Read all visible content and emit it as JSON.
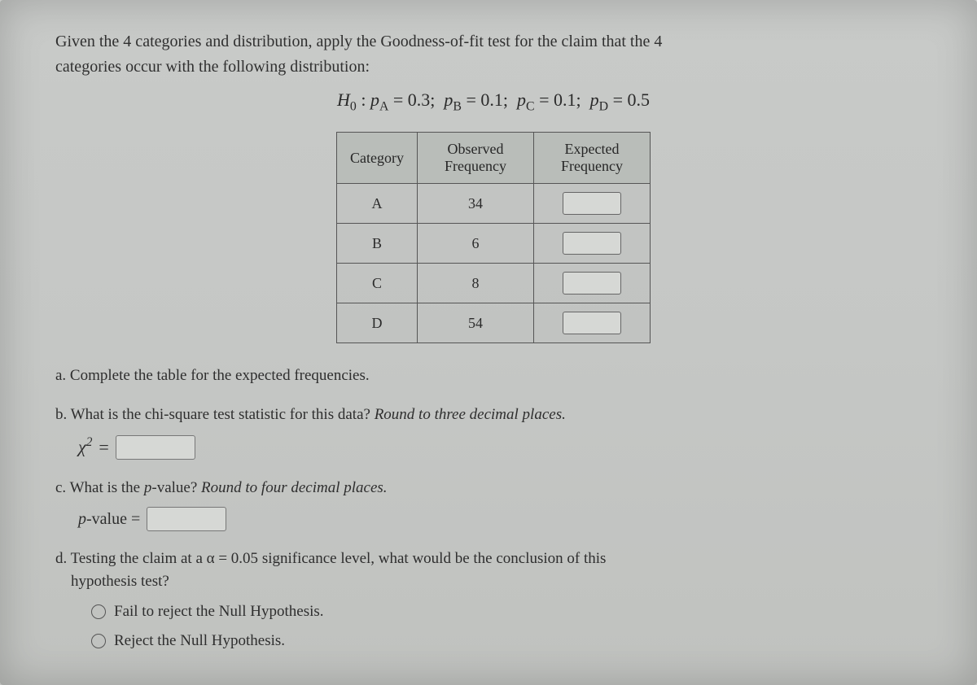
{
  "intro": {
    "line1": "Given the 4 categories and distribution, apply the Goodness-of-fit test for the claim that the 4",
    "line2": "categories occur with the following distribution:"
  },
  "hypothesis": {
    "H0_label": "H",
    "H0_sub": "0",
    "pA_label": "p",
    "pA_sub": "A",
    "pA_val": "0.3",
    "pB_label": "p",
    "pB_sub": "B",
    "pB_val": "0.1",
    "pC_label": "p",
    "pC_sub": "C",
    "pC_val": "0.1",
    "pD_label": "p",
    "pD_sub": "D",
    "pD_val": "0.5"
  },
  "table": {
    "headers": {
      "cat": "Category",
      "obs": "Observed Frequency",
      "exp": "Expected Frequency"
    },
    "rows": [
      {
        "cat": "A",
        "obs": "34"
      },
      {
        "cat": "B",
        "obs": "6"
      },
      {
        "cat": "C",
        "obs": "8"
      },
      {
        "cat": "D",
        "obs": "54"
      }
    ]
  },
  "questions": {
    "a": "a. Complete the table for the expected frequencies.",
    "b_text": "b. What is the chi-square test statistic for this data? ",
    "b_italic": "Round to three decimal places.",
    "chi_label": "χ",
    "chi_sup": "2",
    "equals": " = ",
    "c_text": "c. What is the ",
    "c_italic_p": "p",
    "c_text2": "-value? ",
    "c_italic_round": "Round to four decimal places.",
    "pval_label_italic": "p",
    "pval_label_rest": "-value = ",
    "d_text1": "d. Testing the claim at a ",
    "d_alpha": "α = 0.05",
    "d_text2": " significance level, what would be the conclusion of this",
    "d_text3": "hypothesis test?",
    "radio1": "Fail to reject the Null Hypothesis.",
    "radio2": "Reject the Null Hypothesis."
  }
}
